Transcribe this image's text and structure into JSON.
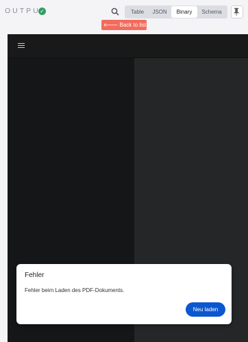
{
  "output_panel": {
    "title": "OUTPUT",
    "status_icon": "check-circle-icon",
    "status_color": "#2f9e61",
    "search_icon": "search-icon",
    "tabs": [
      {
        "label": "Table",
        "active": false
      },
      {
        "label": "JSON",
        "active": false
      },
      {
        "label": "Binary",
        "active": true
      },
      {
        "label": "Schema",
        "active": false
      }
    ],
    "pin_icon": "pin-icon"
  },
  "back_button": {
    "label": "Back to list",
    "icon": "arrow-left-icon",
    "color": "#f26b5c"
  },
  "pdf_viewer": {
    "menu_icon": "hamburger-menu-icon"
  },
  "error_dialog": {
    "title": "Fehler",
    "message": "Fehler beim Laden des PDF-Dokuments.",
    "button_label": "Neu laden",
    "button_color": "#0b57d0"
  }
}
